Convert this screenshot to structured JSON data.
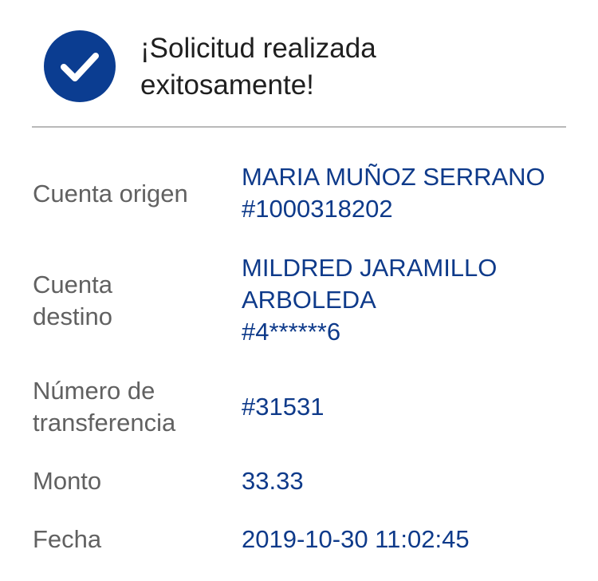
{
  "header": {
    "icon": "check-circle-icon",
    "title_line1": "¡Solicitud realizada",
    "title_line2": "exitosamente!"
  },
  "colors": {
    "accent": "#0b3d91",
    "value_text": "#0e3a8a",
    "label_text": "#616161",
    "divider": "#b9b9b9"
  },
  "details": {
    "origin": {
      "label": "Cuenta origen",
      "name": "MARIA MUÑOZ SERRANO",
      "account": "#1000318202"
    },
    "destination": {
      "label_line1": "Cuenta",
      "label_line2": "destino",
      "name_line1": "MILDRED JARAMILLO",
      "name_line2": "ARBOLEDA",
      "account": "#4******6"
    },
    "transfer_number": {
      "label_line1": "Número de",
      "label_line2": "transferencia",
      "value": "#31531"
    },
    "amount": {
      "label": "Monto",
      "value": "33.33"
    },
    "date": {
      "label": "Fecha",
      "value": "2019-10-30 11:02:45"
    }
  }
}
